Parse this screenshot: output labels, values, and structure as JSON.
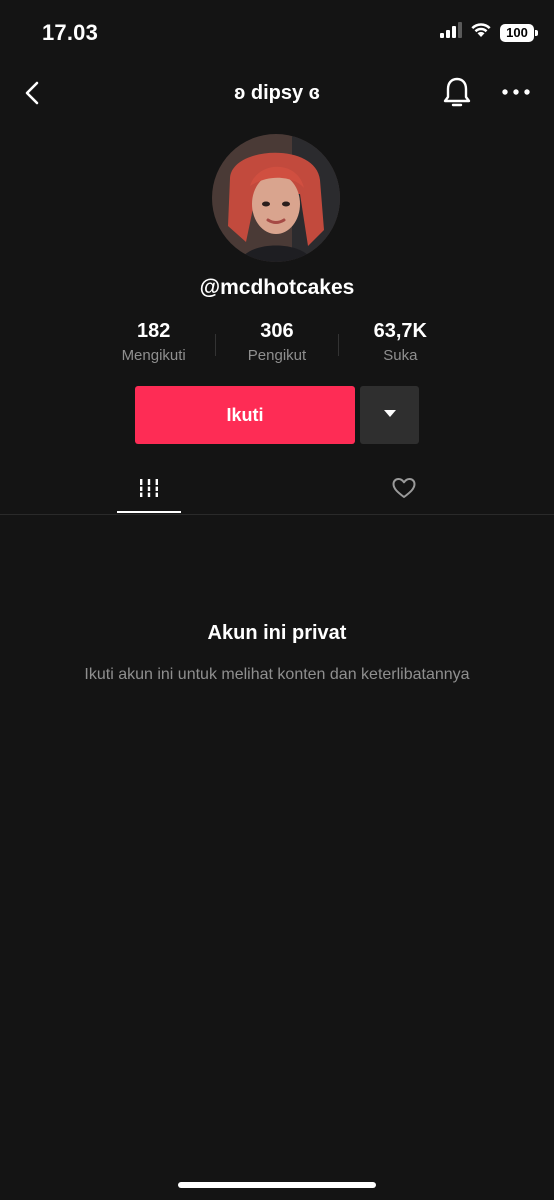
{
  "status_bar": {
    "time": "17.03",
    "battery": "100",
    "icons": [
      "cellular-signal-icon",
      "wifi-icon",
      "battery-icon"
    ]
  },
  "nav": {
    "title": "ʚ dipsy ɞ",
    "icons": [
      "back-chevron-icon",
      "bell-icon",
      "more-dots-icon"
    ]
  },
  "profile": {
    "username": "@mcdhotcakes",
    "stats": [
      {
        "value": "182",
        "label": "Mengikuti"
      },
      {
        "value": "306",
        "label": "Pengikut"
      },
      {
        "value": "63,7K",
        "label": "Suka"
      }
    ]
  },
  "actions": {
    "follow_label": "Ikuti",
    "dropdown_icon": "caret-down-icon"
  },
  "tabs": [
    {
      "name": "videos",
      "icon": "grid-icon",
      "active": true
    },
    {
      "name": "liked",
      "icon": "heart-outline-icon",
      "active": false
    }
  ],
  "private": {
    "title": "Akun ini privat",
    "subtitle": "Ikuti akun ini untuk melihat konten dan keterlibatannya"
  },
  "colors": {
    "background": "#141414",
    "accent": "#fe2c55",
    "secondary_text": "#8f8f8f",
    "dropdown_button": "#2f2f2f"
  }
}
